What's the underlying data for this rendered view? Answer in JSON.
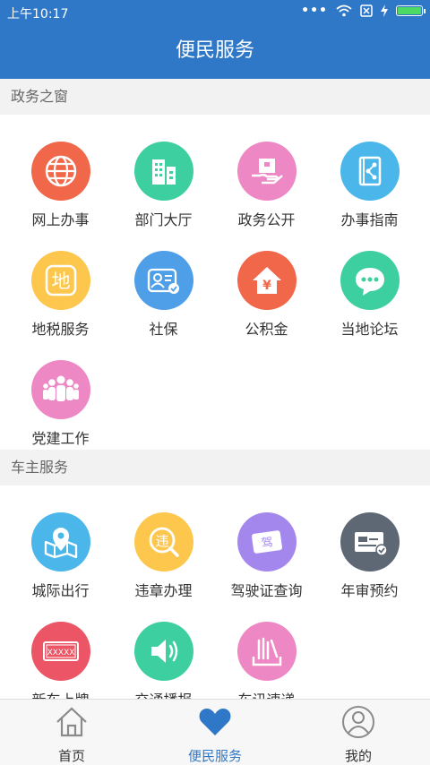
{
  "status_bar": {
    "time": "上午10:17",
    "dots": "•••"
  },
  "title": "便民服务",
  "sections": [
    {
      "title": "政务之窗",
      "items": [
        {
          "label": "网上办事",
          "icon": "globe-icon",
          "color": "#f0674a"
        },
        {
          "label": "部门大厅",
          "icon": "building-icon",
          "color": "#3ecfa0"
        },
        {
          "label": "政务公开",
          "icon": "hand-box-icon",
          "color": "#ee88c4"
        },
        {
          "label": "办事指南",
          "icon": "share-book-icon",
          "color": "#4ab6ea"
        },
        {
          "label": "地税服务",
          "icon": "tax-icon",
          "color": "#fdc74d",
          "glyph": "地"
        },
        {
          "label": "社保",
          "icon": "id-card-icon",
          "color": "#4f9ee8"
        },
        {
          "label": "公积金",
          "icon": "house-yuan-icon",
          "color": "#f0674a",
          "glyph": "¥"
        },
        {
          "label": "当地论坛",
          "icon": "chat-bubble-icon",
          "color": "#3ecfa0"
        },
        {
          "label": "党建工作",
          "icon": "people-group-icon",
          "color": "#ee88c4"
        }
      ]
    },
    {
      "title": "车主服务",
      "items": [
        {
          "label": "城际出行",
          "icon": "map-pin-icon",
          "color": "#4ab6ea"
        },
        {
          "label": "违章办理",
          "icon": "violation-search-icon",
          "color": "#fdc74d",
          "glyph": "违"
        },
        {
          "label": "驾驶证查询",
          "icon": "license-card-icon",
          "color": "#a487ec",
          "glyph": "驾"
        },
        {
          "label": "年审预约",
          "icon": "inspection-card-icon",
          "color": "#5e6875"
        },
        {
          "label": "新车上牌",
          "icon": "license-plate-icon",
          "color": "#ec5566",
          "glyph": "XXXXX"
        },
        {
          "label": "交通播报",
          "icon": "speaker-icon",
          "color": "#3ecfa0"
        },
        {
          "label": "车讯速递",
          "icon": "news-bars-icon",
          "color": "#ee88c4"
        }
      ]
    }
  ],
  "tabs": [
    {
      "label": "首页",
      "icon": "home-icon",
      "active": false
    },
    {
      "label": "便民服务",
      "icon": "heart-icon",
      "active": true
    },
    {
      "label": "我的",
      "icon": "user-icon",
      "active": false
    }
  ],
  "colors": {
    "primary": "#2f78c8",
    "battery": "#4cd964"
  },
  "battery_level": 1.0
}
